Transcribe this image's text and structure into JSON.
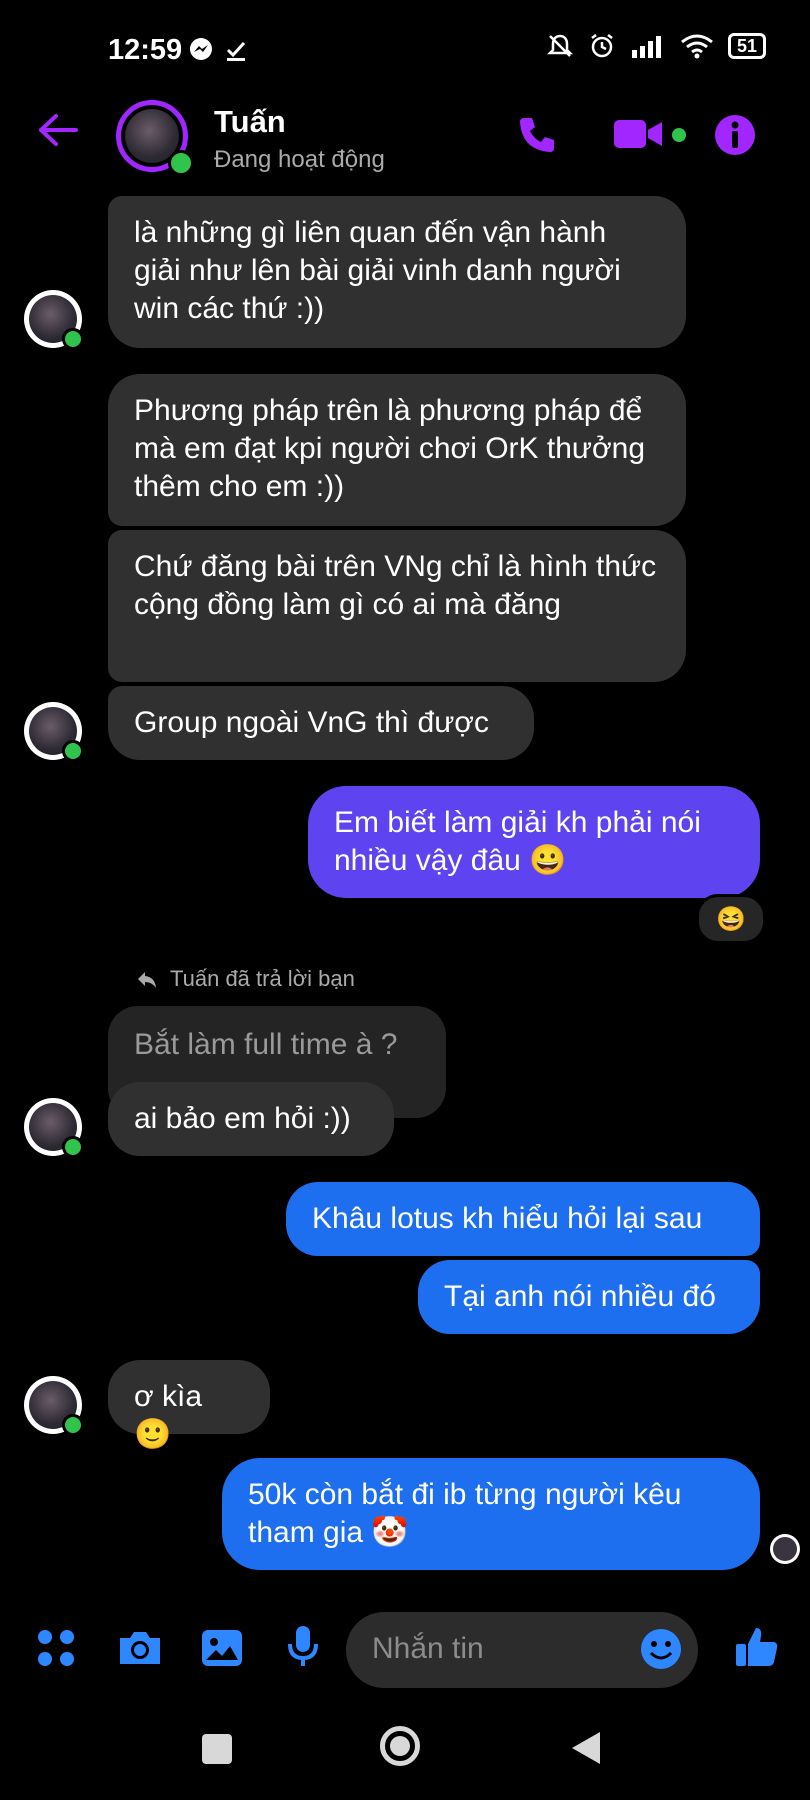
{
  "status_bar": {
    "time": "12:59",
    "battery": "51"
  },
  "header": {
    "name": "Tuấn",
    "status": "Đang hoạt động"
  },
  "messages": {
    "m1": "là những gì liên quan đến vận hành giải như lên bài giải vinh danh người win các thứ :))",
    "m2": "Phương pháp trên là phương pháp để mà em đạt kpi người chơi OrK thưởng thêm cho em :))",
    "m3": "Chứ đăng bài trên VNg chỉ là hình thức cộng đồng làm gì có ai mà đăng",
    "m4": "Group ngoài VnG thì được",
    "m5": "Em biết làm giải kh phải nói nhiều vậy đâu 😀",
    "m5_reaction": "😆",
    "reply_label": "Tuấn đã trả lời bạn",
    "quoted": "Bắt làm full time à ?",
    "m6": "ai bảo em hỏi :))",
    "m7": "Khâu lotus kh hiểu hỏi lại sau",
    "m8": "Tại anh nói nhiều đó",
    "m9": "ơ kìa 🙂",
    "m10": "50k còn bắt đi ib từng người kêu tham gia 🤡"
  },
  "composer": {
    "placeholder": "Nhắn tin"
  },
  "colors": {
    "accent": "#a126ff",
    "outgoing_purple": "#5e43f0",
    "outgoing_blue": "#1e6ff0",
    "incoming": "#303030",
    "online": "#31c44c"
  }
}
